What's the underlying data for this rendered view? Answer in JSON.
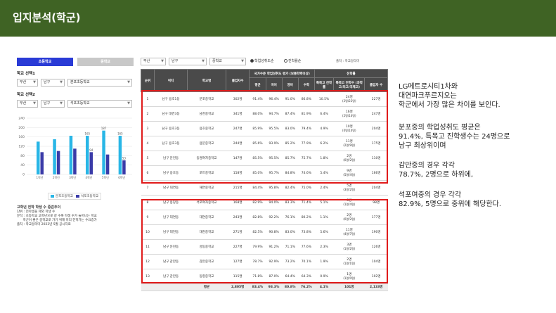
{
  "header": {
    "title": "입지분석(학군)"
  },
  "left": {
    "tabs": [
      "초등학교",
      "중학교"
    ],
    "school_select_1_label": "학교 선택1",
    "school_select_1": [
      "부산",
      "남구",
      "분포초등학교"
    ],
    "school_select_2_label": "학교 선택2",
    "school_select_2": [
      "부산",
      "남구",
      "석포초등학교"
    ],
    "legend": [
      "분포초등학교",
      "석포초등학교"
    ],
    "colors": {
      "series1": "#29b6e6",
      "series2": "#3a3ba8"
    },
    "notes_title": "고학년 전학 학생 수 증감추이",
    "notes": [
      "단위 : 전학생을 제외 학생 수",
      "분석 : 초등학교 고학년으로 갈 수록 학생 수가 늘어나는 학교",
      "      학군이 좋은 중학교로 가기 위해 미리 전학가는 수요증가",
      "출처 : 학교알리미 2023년 5월 공시자료"
    ]
  },
  "chart_data": {
    "type": "bar",
    "categories": [
      "1학년",
      "2학년",
      "3학년",
      "4학년",
      "5학년",
      "6학년"
    ],
    "series": [
      {
        "name": "분포초등학교",
        "values": [
          140,
          150,
          165,
          165,
          187,
          165
        ]
      },
      {
        "name": "석포초등학교",
        "values": [
          95,
          100,
          110,
          95,
          85,
          60
        ]
      }
    ],
    "data_labels": [
      "",
      "",
      "",
      "165",
      "187",
      "165"
    ],
    "data_labels_2": [
      "",
      "",
      "",
      "94",
      "",
      "53"
    ],
    "yticks": [
      "240",
      "200",
      "160",
      "120",
      "80",
      "40",
      "0"
    ],
    "ylim": [
      0,
      240
    ]
  },
  "filters": {
    "city": "부산",
    "district": "남구",
    "level": "중학교",
    "radio_1": "학업성취도순",
    "radio_2": "진학률순",
    "source": "출처 : 학교알리미"
  },
  "table": {
    "header_rank": "순위",
    "header_loc": "위치",
    "header_school": "학교명",
    "header_count": "졸업자수",
    "header_group1": "국가수준 학업성취도 평가 (보통학력이상)",
    "header_avg": "평균",
    "header_kor": "국어",
    "header_eng": "영어",
    "header_math": "수학",
    "header_group2": "진학률",
    "header_special": "특목고 진학률",
    "header_special_count": "특목고 진학수 (과학고/외고/국제고)",
    "header_grad": "졸업자 수",
    "rows": [
      [
        "1",
        "남구 용호1동",
        "분포중학교",
        "302명",
        "91.4%",
        "96.4%",
        "91.0%",
        "86.8%",
        "10.5%",
        "24명",
        "(2명/22명)",
        "227명"
      ],
      [
        "2",
        "남구 대연3동",
        "남천중학교",
        "341명",
        "88.0%",
        "94.7%",
        "87.4%",
        "81.9%",
        "6.4%",
        "16명",
        "(2명/14명)",
        "247명"
      ],
      [
        "3",
        "남구 용호3동",
        "용호중학교",
        "247명",
        "85.9%",
        "95.5%",
        "83.0%",
        "79.4%",
        "4.9%",
        "10명",
        "(0명/10명)",
        "204명"
      ],
      [
        "4",
        "남구 용호3동",
        "용문중학교",
        "244명",
        "85.6%",
        "93.9%",
        "85.2%",
        "77.9%",
        "6.2%",
        "11명",
        "(2명/9명)",
        "175명"
      ],
      [
        "5",
        "남구 문현동",
        "동명여자중학교",
        "147명",
        "85.5%",
        "95.5%",
        "85.7%",
        "75.7%",
        "1.8%",
        "2명",
        "(0명/2명)",
        "110명"
      ],
      [
        "6",
        "남구 용호동",
        "포트중학교",
        "158명",
        "85.0%",
        "95.7%",
        "84.8%",
        "74.6%",
        "5.4%",
        "9명",
        "(5명/4명)",
        "166명"
      ],
      [
        "7",
        "남구 대연동",
        "해연중학교",
        "215명",
        "84.4%",
        "95.8%",
        "82.4%",
        "75.0%",
        "2.4%",
        "5명",
        "(3명/2명)",
        "204명"
      ],
      [
        "8",
        "남구 용당동",
        "석포여자중학교",
        "168명",
        "82.9%",
        "94.0%",
        "83.3%",
        "71.4%",
        "5.1%",
        "5명",
        "(1명/4명)",
        "98명"
      ],
      [
        "9",
        "남구 대연동",
        "대연중학교",
        "243명",
        "82.8%",
        "92.2%",
        "76.1%",
        "80.2%",
        "1.1%",
        "2명",
        "(0명/2명)",
        "177명"
      ],
      [
        "10",
        "남구 대연동",
        "대천중학교",
        "271명",
        "82.5%",
        "90.8%",
        "83.0%",
        "73.8%",
        "5.6%",
        "11명",
        "(4명/7명)",
        "190명"
      ],
      [
        "11",
        "남구 문현동",
        "성동중학교",
        "227명",
        "79.9%",
        "91.2%",
        "71.1%",
        "77.6%",
        "2.3%",
        "3명",
        "(1명/2명)",
        "126명"
      ],
      [
        "12",
        "남구 감만동",
        "감만중학교",
        "127명",
        "78.7%",
        "92.9%",
        "73.2%",
        "70.1%",
        "1.9%",
        "2명",
        "(1명/1명)",
        "104명"
      ],
      [
        "13",
        "남구 감만동",
        "동항중학교",
        "115명",
        "71.8%",
        "87.0%",
        "64.4%",
        "64.3%",
        "0.9%",
        "1명",
        "(1명/0명)",
        "102명"
      ]
    ],
    "avg_row": [
      "",
      "",
      "평균",
      "2,805명",
      "83.4%",
      "93.3%",
      "80.8%",
      "76.2%",
      "4.1%",
      "101명",
      "",
      "2,133명"
    ]
  },
  "notes_right": {
    "p1": [
      "LG메트로시티1차와",
      "대연파크푸르지오는",
      "학군에서 가장 많은 차이를 보인다."
    ],
    "p2": [
      "분포중의 학업성취도 평균은",
      "91.4%, 특목고 진학생수는 24명으로",
      "남구 최상위이며"
    ],
    "p3": [
      "감만중의 경우 각각",
      "78.7%, 2명으로 하위에,"
    ],
    "p4": [
      "석포여중의 경우 각각",
      "82.9%, 5명으로 중위에 해당한다."
    ]
  },
  "highlight_color": "#e01b1b"
}
